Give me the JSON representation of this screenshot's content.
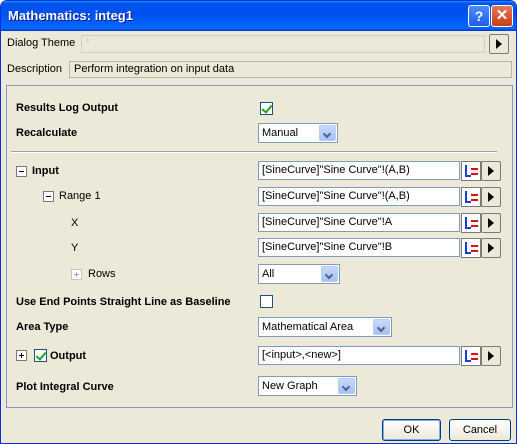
{
  "window": {
    "title": "Mathematics: integ1"
  },
  "title_buttons": {
    "help": "?",
    "close": "✕"
  },
  "header": {
    "dialog_theme_label": "Dialog Theme",
    "dialog_theme_value": "*",
    "description_label": "Description",
    "description_value": "Perform integration on input data"
  },
  "settings": {
    "results_log_output": {
      "label": "Results Log Output",
      "checked": true
    },
    "recalculate": {
      "label": "Recalculate",
      "value": "Manual"
    }
  },
  "input": {
    "label": "Input",
    "value": "[SineCurve]\"Sine Curve\"!(A,B)",
    "range": {
      "label": "Range 1",
      "value": "[SineCurve]\"Sine Curve\"!(A,B)",
      "x": {
        "label": "X",
        "value": "[SineCurve]\"Sine Curve\"!A"
      },
      "y": {
        "label": "Y",
        "value": "[SineCurve]\"Sine Curve\"!B"
      },
      "rows": {
        "label": "Rows",
        "value": "All"
      }
    }
  },
  "options": {
    "baseline": {
      "label": "Use End Points Straight Line as Baseline",
      "checked": false
    },
    "area_type": {
      "label": "Area Type",
      "value": "Mathematical Area"
    },
    "output": {
      "label": "Output",
      "checked": true,
      "value": "[<input>,<new>]"
    },
    "plot_integral_curve": {
      "label": "Plot Integral Curve",
      "value": "New Graph"
    }
  },
  "footer": {
    "ok_label": "OK",
    "cancel_label": "Cancel"
  },
  "colors": {
    "title_bar": "#0054e3",
    "dialog_bg": "#ece9d8",
    "field_border": "#7f9db9"
  }
}
